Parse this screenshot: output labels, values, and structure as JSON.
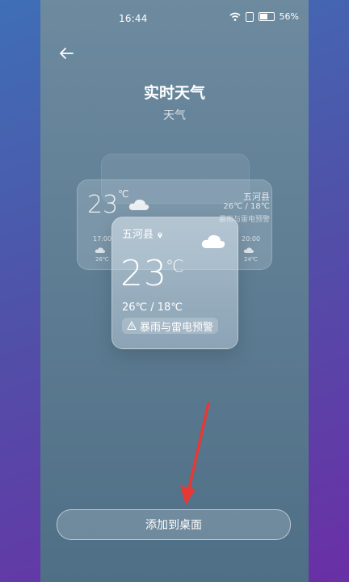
{
  "status_bar": {
    "time": "16:44",
    "battery": "56%"
  },
  "header": {
    "title": "实时天气",
    "subtitle": "天气"
  },
  "preview_back": {
    "temp": "23",
    "deg": "℃",
    "city": "五河县",
    "range": "26℃ / 18℃",
    "warning_fragment": "暴雨与雷电预警",
    "hours": [
      {
        "time": "17:00",
        "temp": "26℃"
      },
      {
        "time": "20:00",
        "temp": "24℃"
      }
    ]
  },
  "widget": {
    "city": "五河县",
    "temp": "23",
    "deg": "℃",
    "range": "26℃ / 18℃",
    "warning": "暴雨与雷电预警"
  },
  "actions": {
    "add_label": "添加到桌面"
  },
  "colors": {
    "accent_arrow": "#e53935"
  }
}
